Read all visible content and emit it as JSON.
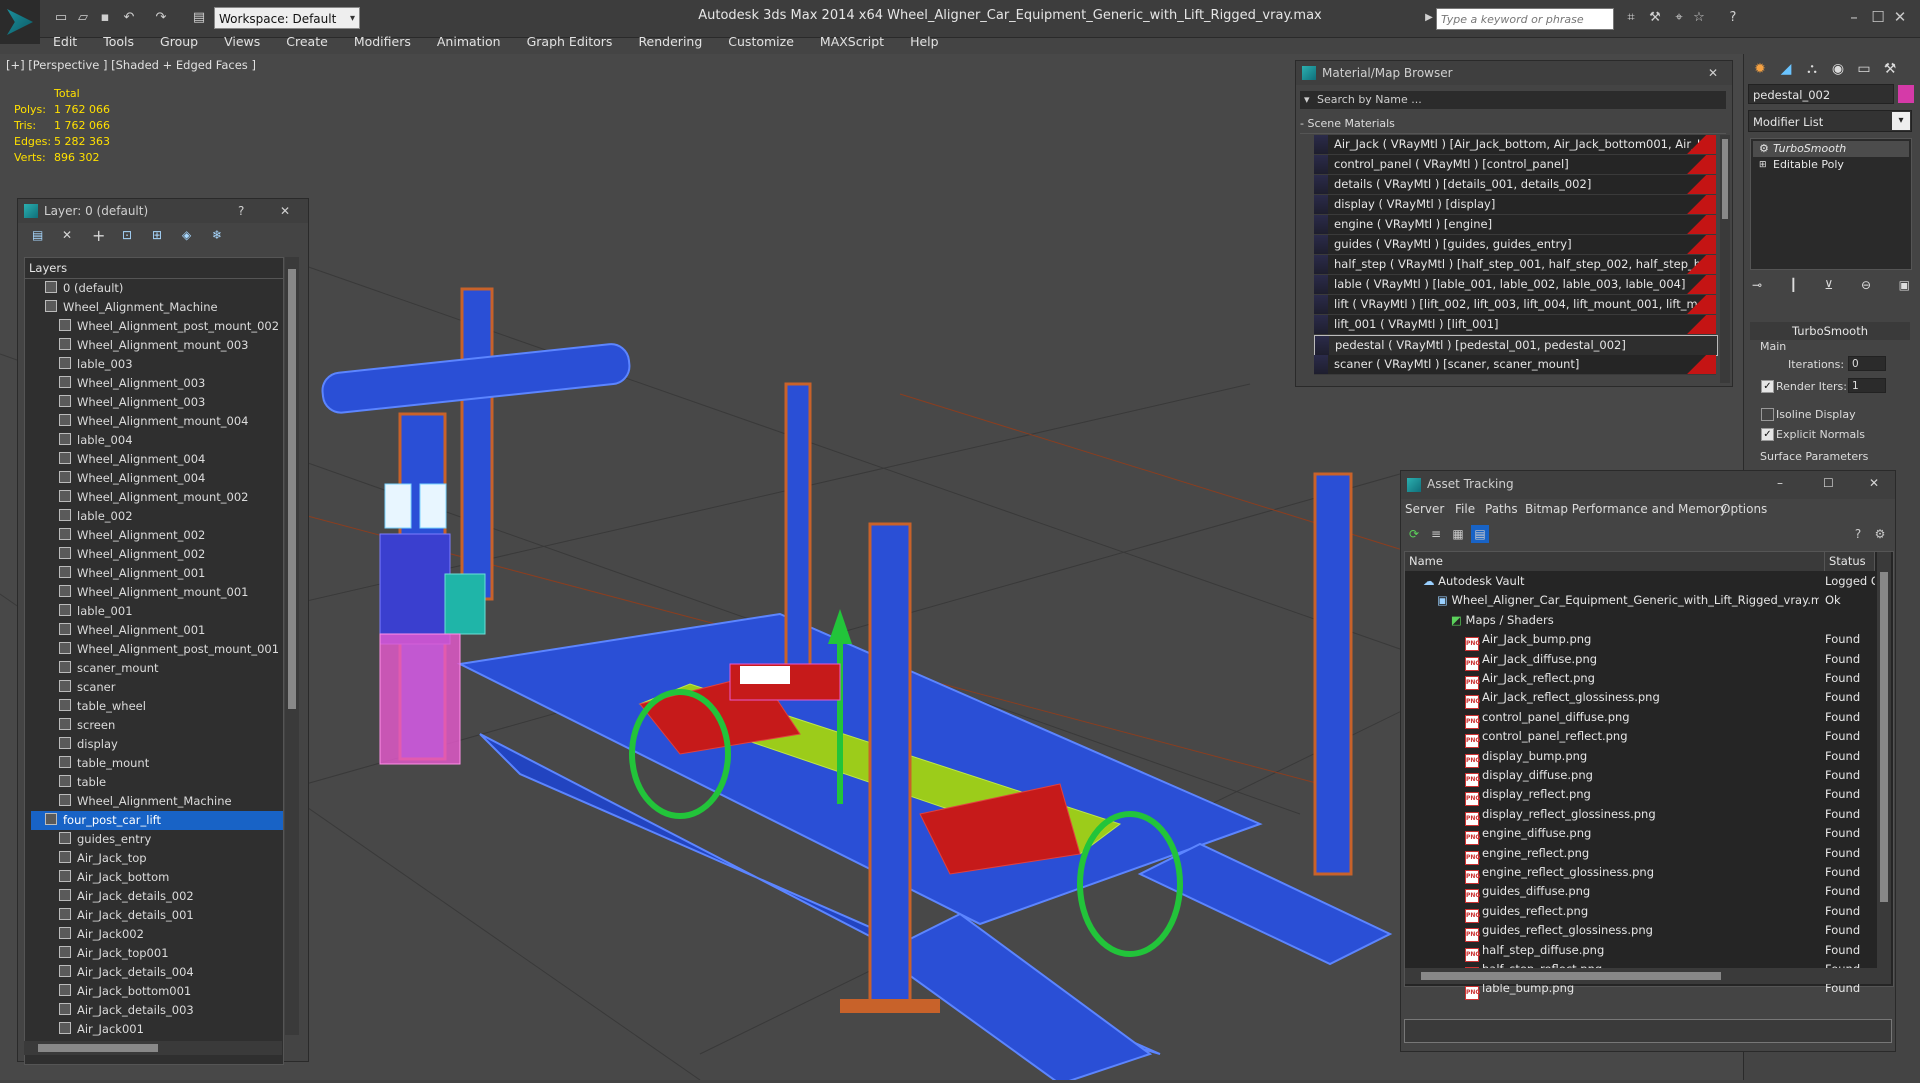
{
  "titlebar": {
    "app_title": "Autodesk 3ds Max  2014 x64      Wheel_Aligner_Car_Equipment_Generic_with_Lift_Rigged_vray.max",
    "workspace": "Workspace: Default",
    "search_placeholder": "Type a keyword or phrase"
  },
  "menu": [
    "Edit",
    "Tools",
    "Group",
    "Views",
    "Create",
    "Modifiers",
    "Animation",
    "Graph Editors",
    "Rendering",
    "Customize",
    "MAXScript",
    "Help"
  ],
  "viewport": {
    "label": "[+] [Perspective ] [Shaded + Edged Faces ]",
    "stats": {
      "header": "Total",
      "rows": [
        {
          "label": "Polys:",
          "value": "1 762 066"
        },
        {
          "label": "Tris:",
          "value": "1 762 066"
        },
        {
          "label": "Edges:",
          "value": "5 282 363"
        },
        {
          "label": "Verts:",
          "value": "896 302"
        }
      ]
    }
  },
  "layer_panel": {
    "title": "Layer: 0 (default)",
    "help": "?",
    "column": "Layers",
    "rows": [
      "0 (default)",
      "Wheel_Alignment_Machine",
      "Wheel_Alignment_post_mount_002",
      "Wheel_Alignment_mount_003",
      "lable_003",
      "Wheel_Alignment_003",
      "Wheel_Alignment_003",
      "Wheel_Alignment_mount_004",
      "lable_004",
      "Wheel_Alignment_004",
      "Wheel_Alignment_004",
      "Wheel_Alignment_mount_002",
      "lable_002",
      "Wheel_Alignment_002",
      "Wheel_Alignment_002",
      "Wheel_Alignment_001",
      "Wheel_Alignment_mount_001",
      "lable_001",
      "Wheel_Alignment_001",
      "Wheel_Alignment_post_mount_001",
      "scaner_mount",
      "scaner",
      "table_wheel",
      "screen",
      "display",
      "table_mount",
      "table",
      "Wheel_Alignment_Machine",
      "four_post_car_lift",
      "guides_entry",
      "Air_Jack_top",
      "Air_Jack_bottom",
      "Air_Jack_details_002",
      "Air_Jack_details_001",
      "Air_Jack002",
      "Air_Jack_top001",
      "Air_Jack_details_004",
      "Air_Jack_bottom001",
      "Air_Jack_details_003",
      "Air_Jack001"
    ],
    "selected_index": 28
  },
  "material_browser": {
    "title": "Material/Map Browser",
    "search_placeholder": "Search by Name ...",
    "group": "- Scene Materials",
    "rows": [
      "Air_Jack  ( VRayMtl ) [Air_Jack_bottom, Air_Jack_bottom001, Air_Jack_...",
      "control_panel  ( VRayMtl ) [control_panel]",
      "details  ( VRayMtl ) [details_001, details_002]",
      "display  ( VRayMtl ) [display]",
      "engine  ( VRayMtl ) [engine]",
      "guides  ( VRayMtl ) [guides, guides_entry]",
      "half_step  ( VRayMtl ) [half_step_001, half_step_002, half_step_bottom...",
      "lable  ( VRayMtl ) [lable_001, lable_002, lable_003, lable_004]",
      "lift  ( VRayMtl ) [lift_002, lift_003, lift_004, lift_mount_001, lift_mount_...",
      "lift_001  ( VRayMtl ) [lift_001]",
      "pedestal  ( VRayMtl ) [pedestal_001, pedestal_002]",
      "scaner  ( VRayMtl ) [scaner, scaner_mount]"
    ],
    "selected_index": 10
  },
  "command_panel": {
    "object_name": "pedestal_002",
    "modifier_list": "Modifier List",
    "stack": [
      "TurboSmooth",
      "Editable Poly"
    ],
    "rollout": "TurboSmooth",
    "main_label": "Main",
    "iterations_label": "Iterations:",
    "iterations_value": "0",
    "render_iters_label": "Render Iters:",
    "render_iters_value": "1",
    "isoline_label": "Isoline Display",
    "explicit_label": "Explicit Normals",
    "surface_label": "Surface Parameters"
  },
  "asset_tracking": {
    "title": "Asset Tracking",
    "menu": [
      "Server",
      "File",
      "Paths",
      "Bitmap Performance and Memory",
      "Options"
    ],
    "col_name": "Name",
    "col_status": "Status",
    "rows": [
      {
        "name": "Autodesk Vault",
        "status": "Logged O",
        "indent": 1,
        "type": "vault"
      },
      {
        "name": "Wheel_Aligner_Car_Equipment_Generic_with_Lift_Rigged_vray.max",
        "status": "Ok",
        "indent": 2,
        "type": "max"
      },
      {
        "name": "Maps / Shaders",
        "status": "",
        "indent": 3,
        "type": "folder"
      },
      {
        "name": "Air_Jack_bump.png",
        "status": "Found",
        "indent": 4,
        "type": "png"
      },
      {
        "name": "Air_Jack_diffuse.png",
        "status": "Found",
        "indent": 4,
        "type": "png"
      },
      {
        "name": "Air_Jack_reflect.png",
        "status": "Found",
        "indent": 4,
        "type": "png"
      },
      {
        "name": "Air_Jack_reflect_glossiness.png",
        "status": "Found",
        "indent": 4,
        "type": "png"
      },
      {
        "name": "control_panel_diffuse.png",
        "status": "Found",
        "indent": 4,
        "type": "png"
      },
      {
        "name": "control_panel_reflect.png",
        "status": "Found",
        "indent": 4,
        "type": "png"
      },
      {
        "name": "display_bump.png",
        "status": "Found",
        "indent": 4,
        "type": "png"
      },
      {
        "name": "display_diffuse.png",
        "status": "Found",
        "indent": 4,
        "type": "png"
      },
      {
        "name": "display_reflect.png",
        "status": "Found",
        "indent": 4,
        "type": "png"
      },
      {
        "name": "display_reflect_glossiness.png",
        "status": "Found",
        "indent": 4,
        "type": "png"
      },
      {
        "name": "engine_diffuse.png",
        "status": "Found",
        "indent": 4,
        "type": "png"
      },
      {
        "name": "engine_reflect.png",
        "status": "Found",
        "indent": 4,
        "type": "png"
      },
      {
        "name": "engine_reflect_glossiness.png",
        "status": "Found",
        "indent": 4,
        "type": "png"
      },
      {
        "name": "guides_diffuse.png",
        "status": "Found",
        "indent": 4,
        "type": "png"
      },
      {
        "name": "guides_reflect.png",
        "status": "Found",
        "indent": 4,
        "type": "png"
      },
      {
        "name": "guides_reflect_glossiness.png",
        "status": "Found",
        "indent": 4,
        "type": "png"
      },
      {
        "name": "half_step_diffuse.png",
        "status": "Found",
        "indent": 4,
        "type": "png"
      },
      {
        "name": "half_step_reflect.png",
        "status": "Found",
        "indent": 4,
        "type": "png"
      },
      {
        "name": "lable_bump.png",
        "status": "Found",
        "indent": 4,
        "type": "png"
      }
    ]
  },
  "colors": {
    "stats_yellow": "#ffe000",
    "selection_blue": "#1863c6",
    "wire_blue": "#2a4fd6",
    "wire_orange": "#c8622a",
    "wire_green": "#22c43a",
    "wire_pink": "#e85ad0",
    "wire_red": "#c61a1a"
  }
}
